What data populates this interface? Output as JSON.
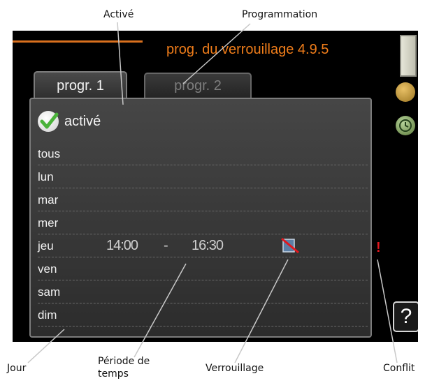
{
  "callouts": {
    "active": "Activé",
    "schedule": "Programmation",
    "day": "Jour",
    "period": "Période de temps",
    "lock": "Verrouillage",
    "conflict": "Conflit"
  },
  "screen": {
    "title": "prog. du verrouillage 4.9.5",
    "tabs": [
      {
        "label": "progr. 1",
        "selected": true
      },
      {
        "label": "progr. 2",
        "selected": false
      }
    ],
    "active_label": "activé",
    "days": [
      {
        "label": "tous"
      },
      {
        "label": "lun"
      },
      {
        "label": "mar"
      },
      {
        "label": "mer"
      },
      {
        "label": "jeu",
        "start": "14:00",
        "separator": "-",
        "end": "16:30"
      },
      {
        "label": "ven"
      },
      {
        "label": "sam"
      },
      {
        "label": "dim"
      }
    ],
    "conflict_marker": "!",
    "help_label": "?"
  },
  "colors": {
    "title_orange": "#f07d1a",
    "conflict_red": "#e0181e",
    "check_green": "#4ab23a"
  }
}
